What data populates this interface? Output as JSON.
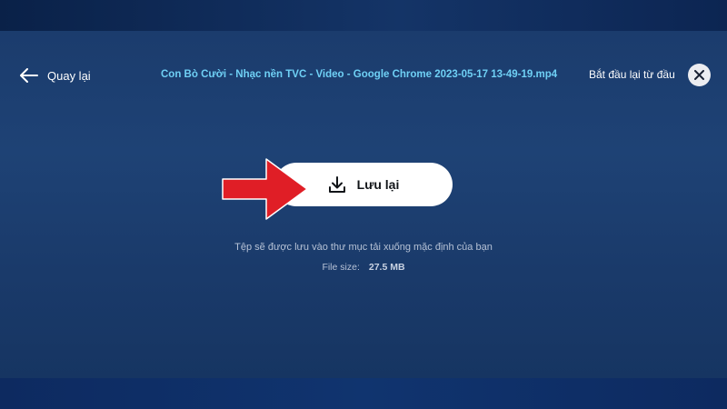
{
  "header": {
    "back_label": "Quay lại",
    "file_title": "Con Bò Cười - Nhạc nền TVC - Video - Google Chrome 2023-05-17 13-49-19.mp4",
    "restart_label": "Bắt đầu lại từ đầu"
  },
  "main": {
    "save_label": "Lưu lại",
    "info_text": "Tệp sẽ được lưu vào thư mục tải xuống mặc định của bạn",
    "file_size_label": "File size:",
    "file_size_value": "27.5 MB"
  },
  "icons": {
    "back": "arrow-left-icon",
    "close": "close-icon",
    "download": "download-icon",
    "annotation": "red-arrow-annotation"
  },
  "colors": {
    "background": "#1e4275",
    "title_accent": "#6fd0f5",
    "button_bg": "#ffffff",
    "annotation_red": "#e01e26"
  }
}
